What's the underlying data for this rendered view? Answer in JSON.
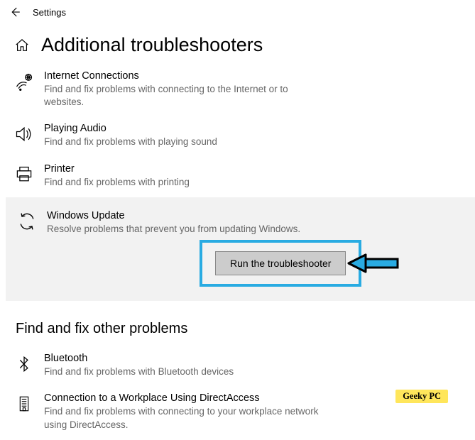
{
  "header": {
    "settings_label": "Settings"
  },
  "page": {
    "title": "Additional troubleshooters"
  },
  "troubleshooters": {
    "internet": {
      "title": "Internet Connections",
      "desc": "Find and fix problems with connecting to the Internet or to websites."
    },
    "audio": {
      "title": "Playing Audio",
      "desc": "Find and fix problems with playing sound"
    },
    "printer": {
      "title": "Printer",
      "desc": "Find and fix problems with printing"
    },
    "winupdate": {
      "title": "Windows Update",
      "desc": "Resolve problems that prevent you from updating Windows."
    },
    "run_button_label": "Run the troubleshooter"
  },
  "section2": {
    "header": "Find and fix other problems",
    "bluetooth": {
      "title": "Bluetooth",
      "desc": "Find and fix problems with Bluetooth devices"
    },
    "directaccess": {
      "title": "Connection to a Workplace Using DirectAccess",
      "desc": "Find and fix problems with connecting to your workplace network using DirectAccess."
    }
  },
  "watermark": "Geeky PC"
}
